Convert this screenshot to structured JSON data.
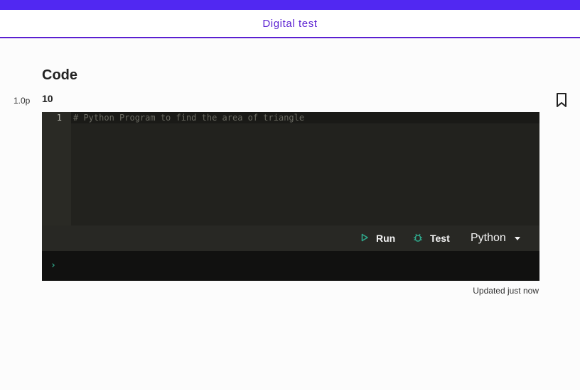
{
  "header": {
    "title": "Digital test"
  },
  "question": {
    "section_title": "Code",
    "points": "1.0p",
    "text": "10"
  },
  "editor": {
    "lines": [
      {
        "number": "1",
        "text": "# Python Program to find the area of triangle"
      }
    ]
  },
  "toolbar": {
    "run_label": "Run",
    "test_label": "Test",
    "language": "Python"
  },
  "status": {
    "updated": "Updated just now"
  },
  "icons": {
    "bookmark": "bookmark-icon",
    "run": "play-icon",
    "test": "bug-icon",
    "dropdown": "chevron-down-icon",
    "console_prompt": "chevron-right-icon"
  },
  "colors": {
    "accent": "#5128f2",
    "header_text": "#5a1fd1",
    "editor_bg": "#22221e",
    "console_bg": "#111110",
    "icon_green": "#2fa98c"
  }
}
